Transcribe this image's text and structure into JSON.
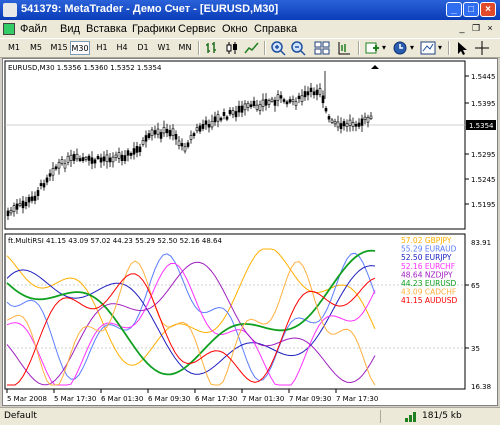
{
  "window": {
    "title": "541379: MetaTrader - Демо Счет - [EURUSD,M30]"
  },
  "menu": {
    "items": [
      "Файл",
      "Вид",
      "Вставка",
      "Графики",
      "Сервис",
      "Окно",
      "Справка"
    ]
  },
  "toolbar": {
    "timeframes": [
      "M1",
      "M5",
      "M15",
      "M30",
      "H1",
      "H4",
      "D1",
      "W1",
      "MN"
    ],
    "active_timeframe": "M30"
  },
  "main_chart": {
    "header": "EURUSD,M30  1.5356 1.5360 1.5352 1.5354",
    "price_ticks": [
      "1.5445",
      "1.5395",
      "1.5345",
      "1.5295",
      "1.5245",
      "1.5195"
    ],
    "current_price": "1.5354"
  },
  "indicator": {
    "header": "ft.MultiRSI 41.15 43.09 57.02 44.23 55.29 52.50 52.16 48.64",
    "scale_top": "83.91",
    "scale_65": "65",
    "scale_35": "35",
    "scale_bottom": "16.38",
    "legend": [
      {
        "value": "57.02",
        "name": "GBPJPY",
        "color": "#ffb000"
      },
      {
        "value": "55.29",
        "name": "EURAUD",
        "color": "#5b7cff"
      },
      {
        "value": "52.50",
        "name": "EURJPY",
        "color": "#2020c0"
      },
      {
        "value": "52.16",
        "name": "EURCHF",
        "color": "#ff30ff"
      },
      {
        "value": "48.64",
        "name": "NZDJPY",
        "color": "#a020c0"
      },
      {
        "value": "44.23",
        "name": "EURUSD",
        "color": "#10a020"
      },
      {
        "value": "43.09",
        "name": "CADCHF",
        "color": "#ffb040"
      },
      {
        "value": "41.15",
        "name": "AUDUSD",
        "color": "#ff0000"
      }
    ]
  },
  "time_axis": [
    "5 Mar 2008",
    "5 Mar 17:30",
    "6 Mar 01:30",
    "6 Mar 09:30",
    "6 Mar 17:30",
    "7 Mar 01:30",
    "7 Mar 09:30",
    "7 Mar 17:30"
  ],
  "status": {
    "profile": "Default",
    "traffic": "181/5 kb"
  }
}
